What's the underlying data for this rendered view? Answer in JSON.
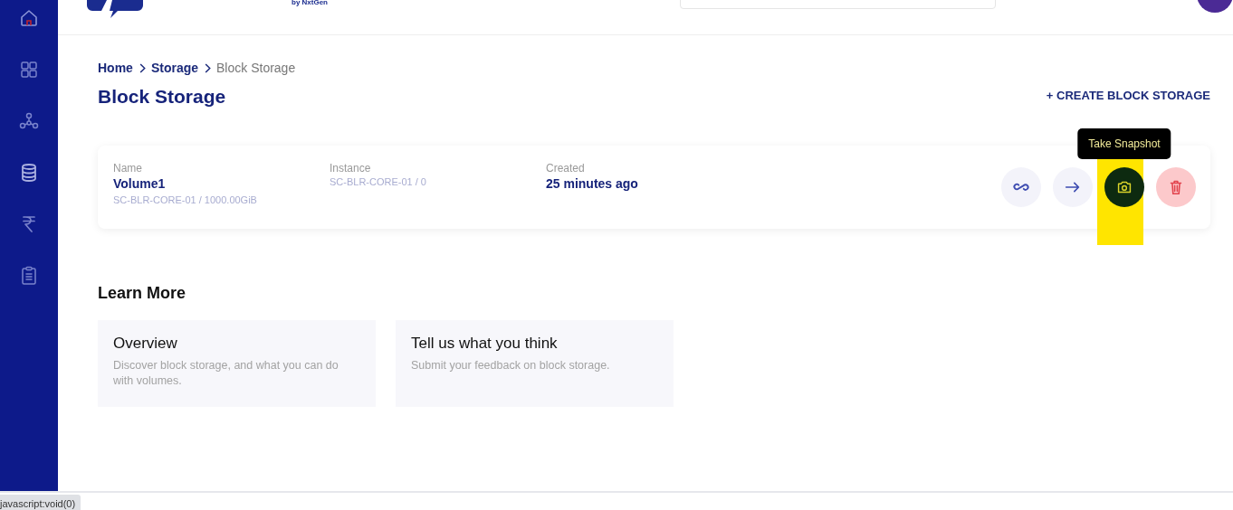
{
  "sidebar": {
    "items": [
      {
        "kind": "home",
        "selected": true
      },
      {
        "kind": "grid",
        "selected": false
      },
      {
        "kind": "network",
        "selected": false
      },
      {
        "kind": "database",
        "selected": false
      },
      {
        "kind": "rupee",
        "selected": false
      },
      {
        "kind": "clipboard",
        "selected": false
      }
    ]
  },
  "header": {
    "logo_tagline": "by NxtGen"
  },
  "breadcrumb": [
    {
      "label": "Home",
      "current": false
    },
    {
      "label": "Storage",
      "current": false
    },
    {
      "label": "Block Storage",
      "current": true
    }
  ],
  "page_title": "Block Storage",
  "create_button": "+ CREATE BLOCK STORAGE",
  "volumes": [
    {
      "fields": [
        {
          "label": "Name",
          "value": "Volume1",
          "detail": "SC-BLR-CORE-01 / 1000.00GiB"
        },
        {
          "label": "Instance",
          "detail": "SC-BLR-CORE-01 / 0"
        },
        {
          "label": "Created",
          "value": "25 minutes ago"
        }
      ],
      "actions": [
        {
          "kind": "attach",
          "highlighted": false
        },
        {
          "kind": "move",
          "highlighted": false
        },
        {
          "kind": "snapshot",
          "highlighted": true,
          "tooltip": "Take Snapshot"
        },
        {
          "kind": "delete",
          "highlighted": false
        }
      ]
    }
  ],
  "learn_more": {
    "title": "Learn More",
    "cards": [
      {
        "title": "Overview",
        "text": "Discover block storage, and what you can do with volumes."
      },
      {
        "title": "Tell us what you think",
        "text": "Submit your feedback on block storage."
      }
    ]
  },
  "status_bar": "javascript:void(0)"
}
